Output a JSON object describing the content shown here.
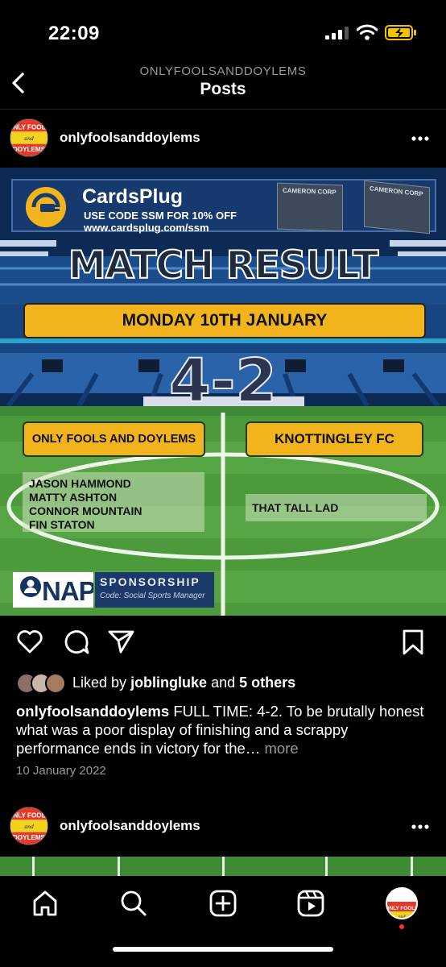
{
  "status": {
    "time": "22:09"
  },
  "header": {
    "username": "ONLYFOOLSANDDOYLEMS",
    "title": "Posts"
  },
  "logo": {
    "line1": "ONLY FOOLS",
    "line2": "and",
    "line3": "DOYLEMS"
  },
  "post": {
    "author": "onlyfoolsanddoylems",
    "image": {
      "ad": {
        "brand": "CardsPlug",
        "code": "USE CODE SSM FOR 10% OFF",
        "url": "www.cardsplug.com/ssm",
        "card_name": "CAMERON CORP"
      },
      "heading": "MATCH RESULT",
      "date": "MONDAY 10TH JANUARY",
      "score": "4-2",
      "home_team": "ONLY FOOLS AND DOYLEMS",
      "away_team": "KNOTTINGLEY FC",
      "home_scorers": [
        "JASON HAMMOND",
        "MATTY ASHTON",
        "CONNOR MOUNTAIN",
        "FIN STATON"
      ],
      "away_scorers": [
        "THAT TALL LAD"
      ],
      "sponsor": {
        "brand": "NAP",
        "label": "SPONSORSHIP",
        "code": "Code: Social Sports Manager"
      }
    },
    "likes": {
      "prefix": "Liked by",
      "user": "joblingluke",
      "and": "and",
      "others": "5 others"
    },
    "caption": {
      "user": "onlyfoolsanddoylems",
      "text": "FULL TIME: 4-2. To be brutally honest what was a poor display of finishing and a scrappy performance ends in victory for the…",
      "more": "more"
    },
    "date": "10 January 2022"
  },
  "next_post": {
    "author": "onlyfoolsanddoylems"
  },
  "colors": {
    "accent_yellow": "#f2b41c",
    "pitch_green": "#4c9a3c",
    "stadium_blue": "#0c2a54",
    "notification_red": "#ff2d2d"
  },
  "nav": {
    "icons": [
      "home-icon",
      "search-icon",
      "create-icon",
      "reels-icon",
      "profile-avatar"
    ]
  }
}
